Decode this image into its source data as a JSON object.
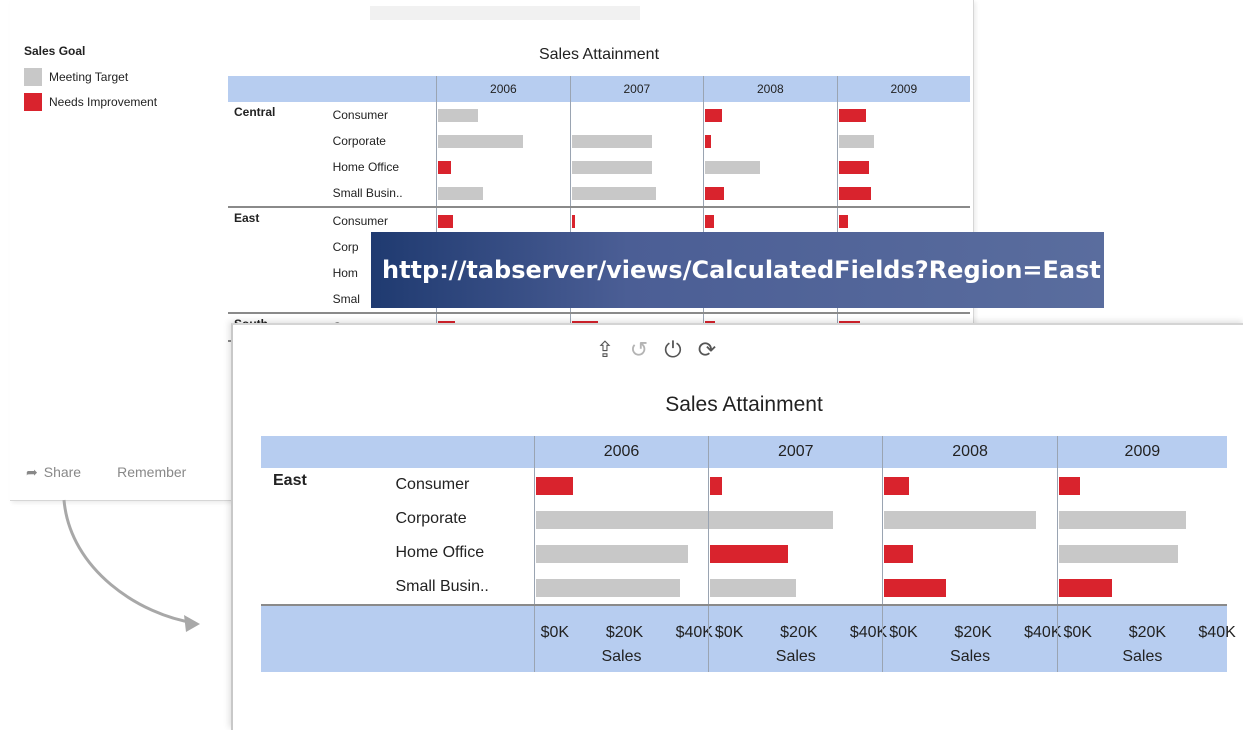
{
  "colors": {
    "meeting": "#c8c8c8",
    "needs": "#d9232d",
    "header": "#b7cdf0"
  },
  "legend": {
    "title": "Sales Goal",
    "items": [
      {
        "label": "Meeting Target",
        "color": "#c8c8c8"
      },
      {
        "label": "Needs Improvement",
        "color": "#d9232d"
      }
    ]
  },
  "share": {
    "share_label": "Share",
    "remember_label": "Remember"
  },
  "back_view": {
    "title": "Sales Attainment",
    "years": [
      "2006",
      "2007",
      "2008",
      "2009"
    ],
    "regions": [
      {
        "name": "Central",
        "segments": [
          "Consumer",
          "Corporate",
          "Home Office",
          "Small Busin.."
        ],
        "bars": [
          [
            {
              "v": 0.31,
              "s": "meeting"
            },
            {
              "v": 0.0,
              "s": "meeting"
            },
            {
              "v": 0.13,
              "s": "needs"
            },
            {
              "v": 0.21,
              "s": "needs"
            }
          ],
          [
            {
              "v": 0.66,
              "s": "meeting"
            },
            {
              "v": 0.62,
              "s": "meeting"
            },
            {
              "v": 0.05,
              "s": "needs"
            },
            {
              "v": 0.27,
              "s": "meeting"
            }
          ],
          [
            {
              "v": 0.1,
              "s": "needs"
            },
            {
              "v": 0.62,
              "s": "meeting"
            },
            {
              "v": 0.43,
              "s": "meeting"
            },
            {
              "v": 0.23,
              "s": "needs"
            }
          ],
          [
            {
              "v": 0.35,
              "s": "meeting"
            },
            {
              "v": 0.65,
              "s": "meeting"
            },
            {
              "v": 0.15,
              "s": "needs"
            },
            {
              "v": 0.25,
              "s": "needs"
            }
          ]
        ]
      },
      {
        "name": "East",
        "segments": [
          "Consumer",
          "Corp",
          "Hom",
          "Smal"
        ],
        "bars": [
          [
            {
              "v": 0.12,
              "s": "needs"
            },
            {
              "v": 0.02,
              "s": "needs"
            },
            {
              "v": 0.07,
              "s": "needs"
            },
            {
              "v": 0.07,
              "s": "needs"
            }
          ],
          [
            {
              "v": 0.0,
              "s": "meeting"
            },
            {
              "v": 0.0,
              "s": "meeting"
            },
            {
              "v": 0.0,
              "s": "meeting"
            },
            {
              "v": 0.0,
              "s": "meeting"
            }
          ],
          [
            {
              "v": 0.0,
              "s": "meeting"
            },
            {
              "v": 0.0,
              "s": "meeting"
            },
            {
              "v": 0.0,
              "s": "meeting"
            },
            {
              "v": 0.0,
              "s": "meeting"
            }
          ],
          [
            {
              "v": 0.0,
              "s": "meeting"
            },
            {
              "v": 0.0,
              "s": "meeting"
            },
            {
              "v": 0.0,
              "s": "meeting"
            },
            {
              "v": 0.0,
              "s": "meeting"
            }
          ]
        ]
      },
      {
        "name": "South",
        "segments": [
          "Consumer"
        ],
        "bars": [
          [
            {
              "v": 0.13,
              "s": "needs"
            },
            {
              "v": 0.2,
              "s": "needs"
            },
            {
              "v": 0.08,
              "s": "needs"
            },
            {
              "v": 0.16,
              "s": "needs"
            }
          ]
        ]
      }
    ]
  },
  "url_banner": "http://tabserver/views/CalculatedFields?Region=East",
  "toolbar": {
    "buttons": [
      {
        "icon": "share-icon",
        "glyph": "⇪",
        "enabled": true
      },
      {
        "icon": "undo-icon",
        "glyph": "↺",
        "enabled": false
      },
      {
        "icon": "power-icon",
        "glyph": "⏻",
        "enabled": true
      },
      {
        "icon": "refresh-icon",
        "glyph": "⟳",
        "enabled": true
      }
    ]
  },
  "chart_data": {
    "type": "bar",
    "title": "Sales Attainment",
    "region": "East",
    "years": [
      "2006",
      "2007",
      "2008",
      "2009"
    ],
    "categories": [
      "Consumer",
      "Corporate",
      "Home Office",
      "Small Busin.."
    ],
    "xlabel": "Sales",
    "xlim": [
      0,
      50000
    ],
    "tick_labels": [
      "$0K",
      "$20K",
      "$40K"
    ],
    "tick_values": [
      0,
      20000,
      40000
    ],
    "series": [
      {
        "year": "2006",
        "values": [
          9000,
          48000,
          37000,
          35000
        ],
        "status": [
          "needs",
          "meeting",
          "meeting",
          "meeting"
        ]
      },
      {
        "year": "2007",
        "values": [
          3000,
          30000,
          19000,
          21000
        ],
        "status": [
          "needs",
          "meeting",
          "needs",
          "meeting"
        ]
      },
      {
        "year": "2008",
        "values": [
          6000,
          37000,
          7000,
          15000
        ],
        "status": [
          "needs",
          "meeting",
          "needs",
          "needs"
        ]
      },
      {
        "year": "2009",
        "values": [
          5000,
          31000,
          29000,
          13000
        ],
        "status": [
          "needs",
          "meeting",
          "meeting",
          "needs"
        ]
      }
    ]
  }
}
